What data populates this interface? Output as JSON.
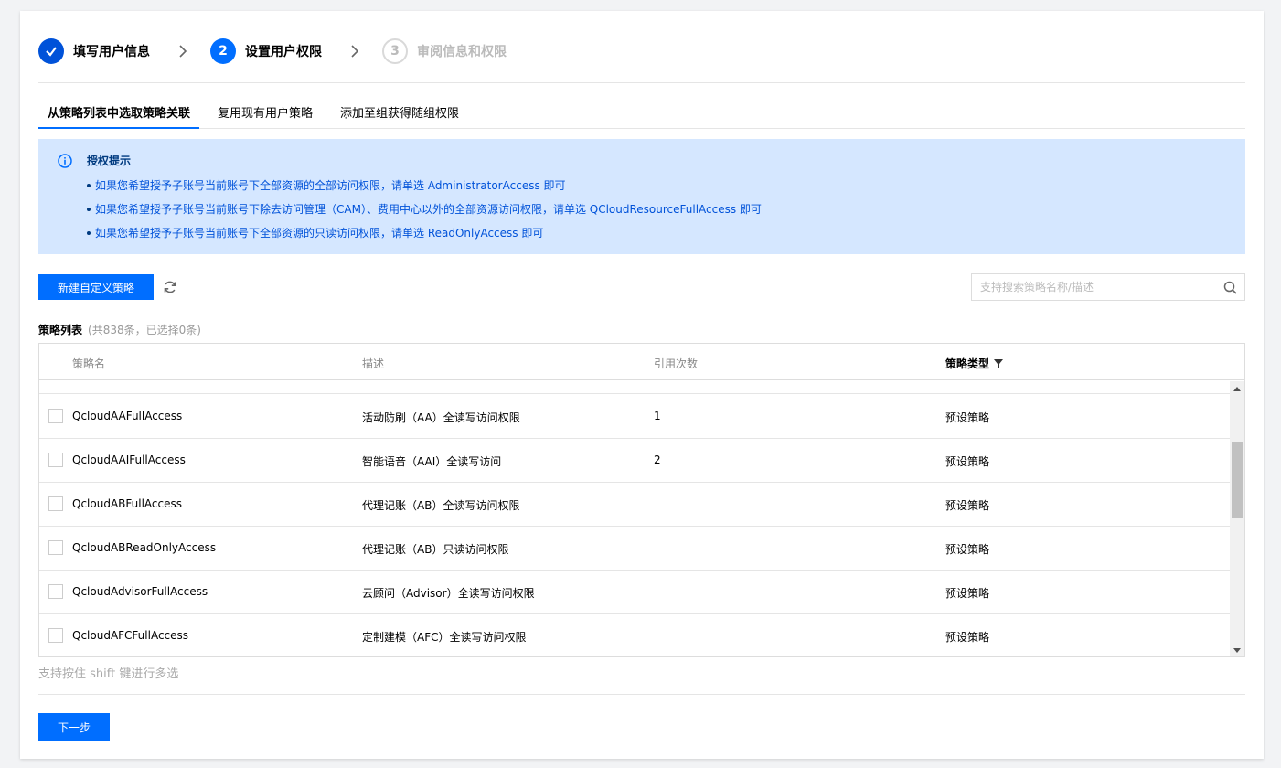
{
  "steps": [
    {
      "label": "填写用户信息",
      "status": "done"
    },
    {
      "label": "设置用户权限",
      "number": "2",
      "status": "active"
    },
    {
      "label": "审阅信息和权限",
      "number": "3",
      "status": "pending"
    }
  ],
  "tabs": [
    {
      "label": "从策略列表中选取策略关联",
      "active": true
    },
    {
      "label": "复用现有用户策略",
      "active": false
    },
    {
      "label": "添加至组获得随组权限",
      "active": false
    }
  ],
  "alert": {
    "title": "授权提示",
    "items": [
      "如果您希望授予子账号当前账号下全部资源的全部访问权限，请单选 AdministratorAccess 即可",
      "如果您希望授予子账号当前账号下除去访问管理（CAM）、费用中心以外的全部资源访问权限，请单选 QCloudResourceFullAccess 即可",
      "如果您希望授予子账号当前账号下全部资源的只读访问权限，请单选 ReadOnlyAccess 即可"
    ]
  },
  "toolbar": {
    "new_policy_label": "新建自定义策略",
    "search_placeholder": "支持搜索策略名称/描述"
  },
  "list": {
    "title": "策略列表",
    "count_text": "(共838条，已选择0条)"
  },
  "table": {
    "columns": [
      "策略名",
      "描述",
      "引用次数",
      "策略类型"
    ],
    "rows": [
      {
        "name": "QcloudAAFullAccess",
        "desc": "活动防刷（AA）全读写访问权限",
        "count": "1",
        "type": "预设策略"
      },
      {
        "name": "QcloudAAIFullAccess",
        "desc": "智能语音（AAI）全读写访问",
        "count": "2",
        "type": "预设策略"
      },
      {
        "name": "QcloudABFullAccess",
        "desc": "代理记账（AB）全读写访问权限",
        "count": "",
        "type": "预设策略"
      },
      {
        "name": "QcloudABReadOnlyAccess",
        "desc": "代理记账（AB）只读访问权限",
        "count": "",
        "type": "预设策略"
      },
      {
        "name": "QcloudAdvisorFullAccess",
        "desc": "云顾问（Advisor）全读写访问权限",
        "count": "",
        "type": "预设策略"
      },
      {
        "name": "QcloudAFCFullAccess",
        "desc": "定制建模（AFC）全读写访问权限",
        "count": "",
        "type": "预设策略"
      }
    ]
  },
  "hint": "支持按住 shift 键进行多选",
  "next_label": "下一步",
  "colors": {
    "primary": "#006eff",
    "alert_bg": "#d5e7ff",
    "alert_text": "#0052d9"
  }
}
